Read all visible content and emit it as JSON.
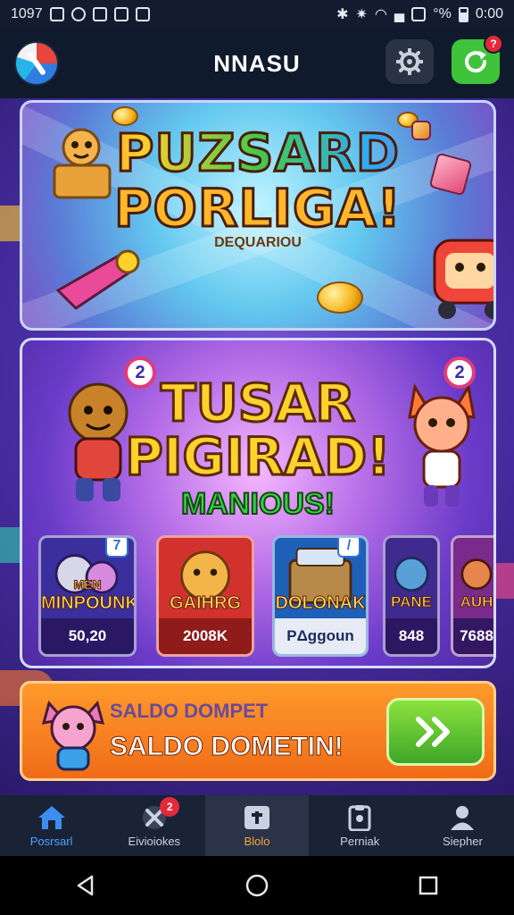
{
  "status_bar": {
    "left_text": "1097",
    "right_text": "°%",
    "time": "0:00"
  },
  "header": {
    "title": "NNASU",
    "refresh_badge": "?",
    "icons": {
      "logo": "app-logo",
      "settings": "gear-icon",
      "refresh": "refresh-icon"
    }
  },
  "banner_top": {
    "line1": "PUZSARD",
    "line2": "PORLIGA!",
    "subtitle": "DEQUARIOU"
  },
  "banner_main": {
    "line1": "TUSAR",
    "line2": "PIGIRAD!",
    "subtitle": "MANIOUS!",
    "badge_left": "2",
    "badge_right": "2"
  },
  "game_cards": [
    {
      "name": "MINPOUNK",
      "overline": "MEN",
      "price": "50,20",
      "badge": "7",
      "color": "#3a2f9c"
    },
    {
      "name": "GAIHRG",
      "price": "2008K",
      "color": "#d2322d"
    },
    {
      "name": "DOLONAK",
      "price": "PΔggoun",
      "badge": "/",
      "color": "#1e5fb8"
    },
    {
      "name": "PANE",
      "price": "848",
      "color": "#3f2a8e"
    },
    {
      "name": "AUH",
      "price": "7688",
      "color": "#7a2a8a"
    }
  ],
  "cta": {
    "label": "SALDO DOMPET",
    "title": "SALDO DOMETIN!",
    "button_icon": "double-chevron-right-icon"
  },
  "bottom_nav": [
    {
      "label": "Posrsarl",
      "icon": "home-icon",
      "active": false,
      "highlight": "home"
    },
    {
      "label": "Eivioiokes",
      "icon": "tools-icon",
      "badge": "2"
    },
    {
      "label": "Blolo",
      "icon": "plus-card-icon",
      "active": true,
      "highlight": "orange"
    },
    {
      "label": "Perniak",
      "icon": "clipboard-icon"
    },
    {
      "label": "Siepher",
      "icon": "person-icon"
    }
  ],
  "android_nav": {
    "icons": [
      "back-triangle-icon",
      "home-circle-icon",
      "recents-square-icon"
    ]
  },
  "colors": {
    "accent_green": "#3fc33a",
    "accent_orange": "#f06c18",
    "header_bg": "#0f1a2c",
    "badge_red": "#e5283a"
  }
}
